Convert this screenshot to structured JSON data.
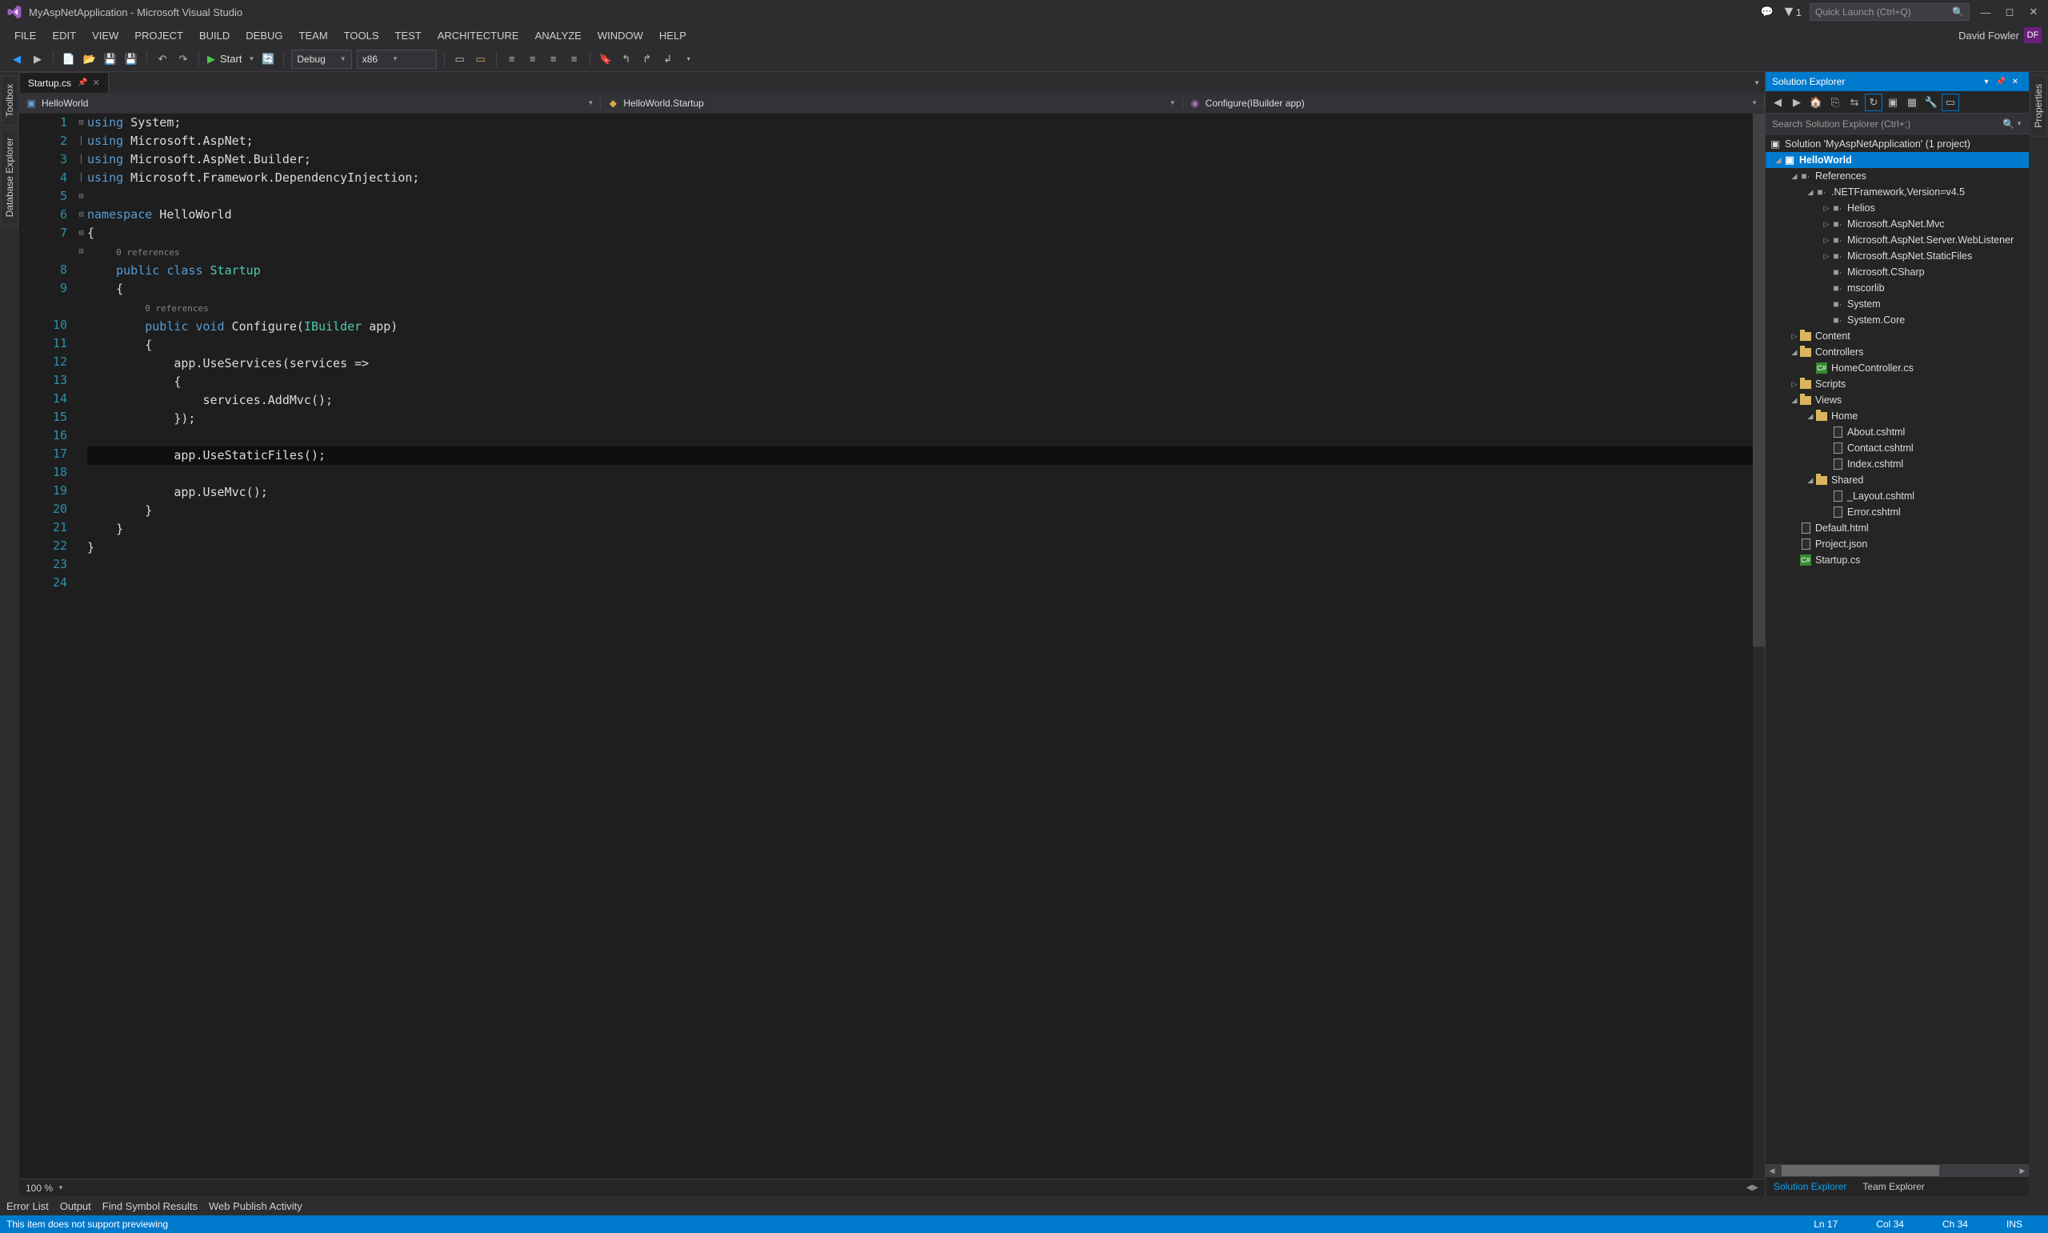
{
  "title": "MyAspNetApplication - Microsoft Visual Studio",
  "notifCount": "1",
  "quickLaunchPlaceholder": "Quick Launch (Ctrl+Q)",
  "menus": [
    "FILE",
    "EDIT",
    "VIEW",
    "PROJECT",
    "BUILD",
    "DEBUG",
    "TEAM",
    "TOOLS",
    "TEST",
    "ARCHITECTURE",
    "ANALYZE",
    "WINDOW",
    "HELP"
  ],
  "userName": "David Fowler",
  "userBadge": "DF",
  "toolbar": {
    "startLabel": "Start",
    "config": "Debug",
    "platform": "x86"
  },
  "leftTabs": [
    "Toolbox",
    "Database Explorer"
  ],
  "rightTabs": [
    "Properties"
  ],
  "tab": {
    "name": "Startup.cs"
  },
  "breadcrumb": {
    "project": "HelloWorld",
    "class": "HelloWorld.Startup",
    "method": "Configure(IBuilder app)"
  },
  "zoom": "100 %",
  "bottomTabs": [
    "Error List",
    "Output",
    "Find Symbol Results",
    "Web Publish Activity"
  ],
  "status": {
    "msg": "This item does not support previewing",
    "ln": "Ln 17",
    "col": "Col 34",
    "ch": "Ch 34",
    "ins": "INS"
  },
  "solExp": {
    "title": "Solution Explorer",
    "searchPlaceholder": "Search Solution Explorer (Ctrl+;)",
    "solution": "Solution 'MyAspNetApplication' (1 project)",
    "project": "HelloWorld",
    "references": "References",
    "framework": ".NETFramework,Version=v4.5",
    "refs": [
      "Helios",
      "Microsoft.AspNet.Mvc",
      "Microsoft.AspNet.Server.WebListener",
      "Microsoft.AspNet.StaticFiles",
      "Microsoft.CSharp",
      "mscorlib",
      "System",
      "System.Core"
    ],
    "content": "Content",
    "controllers": "Controllers",
    "homeCtrl": "HomeController.cs",
    "scripts": "Scripts",
    "views": "Views",
    "home": "Home",
    "homeViews": [
      "About.cshtml",
      "Contact.cshtml",
      "Index.cshtml"
    ],
    "shared": "Shared",
    "sharedViews": [
      "_Layout.cshtml",
      "Error.cshtml"
    ],
    "rootFiles": [
      "Default.html",
      "Project.json",
      "Startup.cs"
    ]
  },
  "panelTabs": {
    "active": "Solution Explorer",
    "other": "Team Explorer"
  },
  "code": {
    "lineNums": [
      "1",
      "2",
      "3",
      "4",
      "5",
      "6",
      "7",
      "8",
      "9",
      "10",
      "11",
      "12",
      "13",
      "14",
      "15",
      "16",
      "17",
      "18",
      "19",
      "20",
      "21",
      "22",
      "23",
      "24"
    ],
    "codelens": "0 references"
  }
}
